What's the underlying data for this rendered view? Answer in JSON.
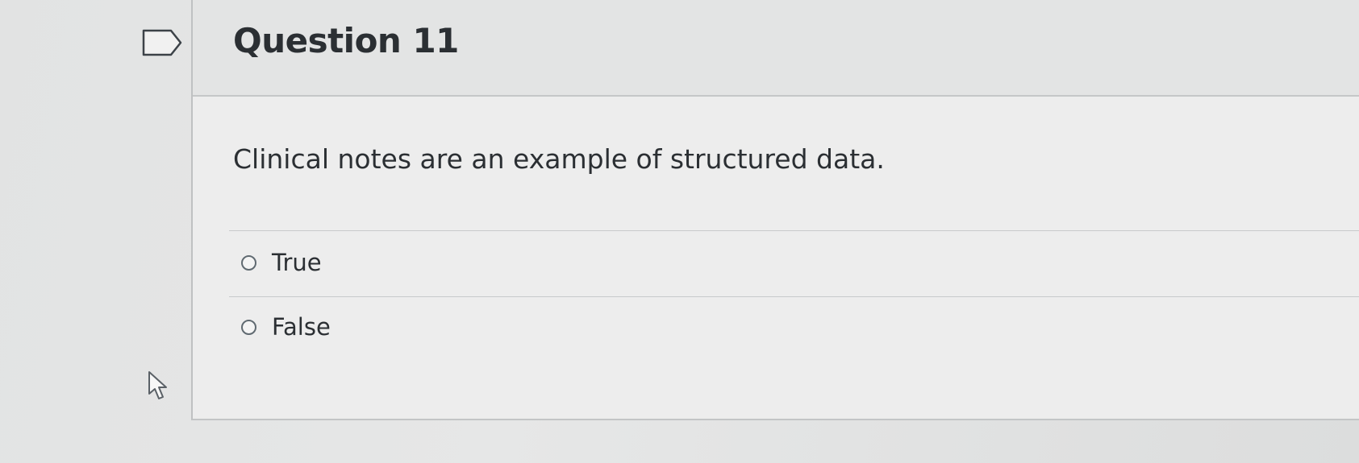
{
  "question": {
    "title": "Question 11",
    "text": "Clinical notes are an example of structured data.",
    "answers": [
      {
        "label": "True",
        "selected": false
      },
      {
        "label": "False",
        "selected": false
      }
    ]
  },
  "icons": {
    "flag": "flag-question-icon",
    "cursor": "mouse-pointer-icon"
  },
  "colors": {
    "background": "#e4e5e5",
    "card": "#ececec",
    "header": "#e3e4e4",
    "text": "#2b2f33",
    "border": "#c5c7c8"
  }
}
